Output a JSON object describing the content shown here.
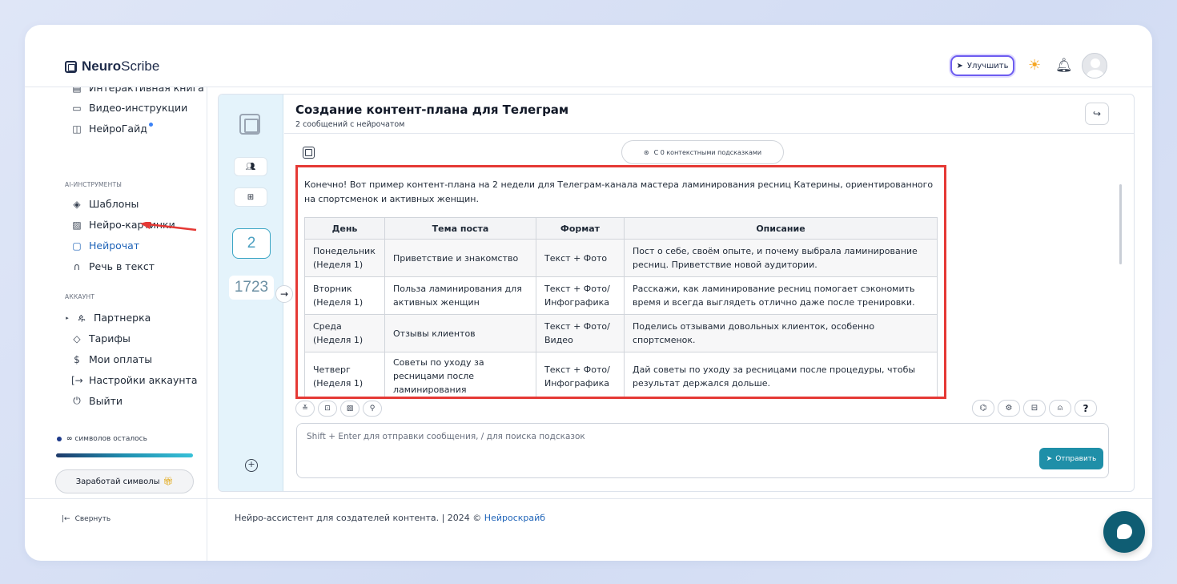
{
  "header": {
    "logo_bold": "Neuro",
    "logo_light": "Scribe",
    "upgrade_label": "Улучшить"
  },
  "sidebar": {
    "items_top": [
      {
        "icon": "book-icon",
        "label": "Интерактивная книга"
      },
      {
        "icon": "video-icon",
        "label": "Видео-инструкции"
      },
      {
        "icon": "guide-icon",
        "label": "НейроГайд"
      }
    ],
    "section_ai": "AI-ИНСТРУМЕНТЫ",
    "items_ai": [
      {
        "icon": "layers-icon",
        "label": "Шаблоны"
      },
      {
        "icon": "image-icon",
        "label": "Нейро-картинки"
      },
      {
        "icon": "chat-icon",
        "label": "Нейрочат"
      },
      {
        "icon": "headphones-icon",
        "label": "Речь в текст"
      }
    ],
    "section_account": "АККАУНТ",
    "items_account": [
      {
        "icon": "users-icon",
        "label": "Партнерка"
      },
      {
        "icon": "tag-icon",
        "label": "Тарифы"
      },
      {
        "icon": "dollar-icon",
        "label": "Мои оплаты"
      },
      {
        "icon": "login-icon",
        "label": "Настройки аккаунта"
      },
      {
        "icon": "power-icon",
        "label": "Выйти"
      }
    ],
    "symbols_prefix": "∞",
    "symbols_left": "символов осталось",
    "earn_label": "Заработай символы",
    "collapse_label": "Свернуть"
  },
  "chat": {
    "title": "Создание контент-плана для Телеграм",
    "subtitle": "2 сообщений с нейрочатом",
    "messages_count": "2",
    "tokens_count": "1723",
    "context_hint": "С 0 контекстными подсказками",
    "message_intro": "Конечно! Вот пример контент-плана на 2 недели для Телеграм-канала мастера ламинирования ресниц Катерины, ориентированного на спортсменок и активных женщин.",
    "table": {
      "headers": [
        "День",
        "Тема поста",
        "Формат",
        "Описание"
      ],
      "rows": [
        [
          "Понедельник (Неделя 1)",
          "Приветствие и знакомство",
          "Текст + Фото",
          "Пост о себе, своём опыте, и почему выбрала ламинирование ресниц. Приветствие новой аудитории."
        ],
        [
          "Вторник (Неделя 1)",
          "Польза ламинирования для активных женщин",
          "Текст + Фото/ Инфографика",
          "Расскажи, как ламинирование ресниц помогает сэкономить время и всегда выглядеть отлично даже после тренировки."
        ],
        [
          "Среда (Неделя 1)",
          "Отзывы клиентов",
          "Текст + Фото/ Видео",
          "Поделись отзывами довольных клиенток, особенно спортсменок."
        ],
        [
          "Четверг (Неделя 1)",
          "Советы по уходу за ресницами после ламинирования",
          "Текст + Фото/ Инфографика",
          "Дай советы по уходу за ресницами после процедуры, чтобы результат держался дольше."
        ]
      ]
    },
    "input_placeholder": "Shift + Enter для отправки сообщения, / для поиска подсказок",
    "send_label": "Отправить",
    "help_label": "?"
  },
  "footer": {
    "text": "Нейро-ассистент для создателей контента.  | 2024 ©",
    "link": "Нейроскрайб"
  },
  "colors": {
    "accent": "#1f8fa8",
    "highlight_border": "#e53935",
    "upgrade_border": "#6d5cf0",
    "fab": "#0f5d73"
  }
}
